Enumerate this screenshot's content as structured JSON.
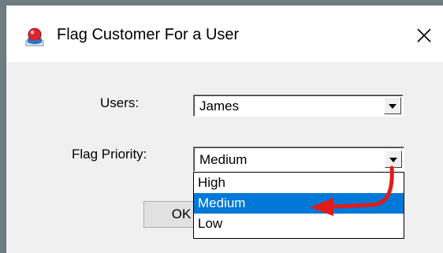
{
  "window": {
    "title": "Flag Customer For a User",
    "close_glyph": "✕"
  },
  "form": {
    "users_label": "Users:",
    "users_value": "James",
    "priority_label": "Flag Priority:",
    "priority_value": "Medium",
    "ok_label": "OK"
  },
  "dropdown": {
    "options": [
      "High",
      "Medium",
      "Low"
    ],
    "selected_index": 1
  },
  "colors": {
    "selection": "#0078d7",
    "annotation_arrow": "#e01b1b"
  }
}
